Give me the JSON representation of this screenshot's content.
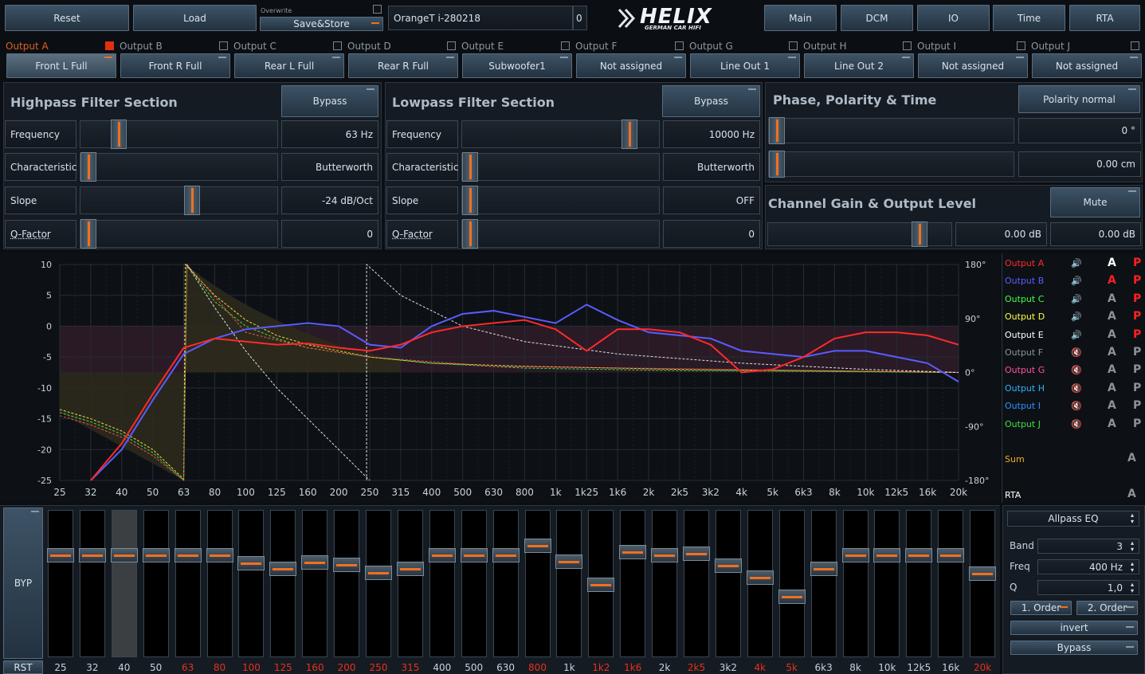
{
  "top": {
    "reset": "Reset",
    "load": "Load",
    "overwrite": "Overwrite",
    "save": "Save&Store",
    "preset_name": "OrangeT i-280218",
    "preset_num": "0",
    "logo": "HELIX",
    "logo_sub": "GERMAN CAR HIFI",
    "nav": [
      "Main",
      "DCM",
      "IO",
      "Time",
      "RTA"
    ]
  },
  "outputs": [
    {
      "label": "Output A",
      "assign": "Front L Full",
      "checked": true
    },
    {
      "label": "Output B",
      "assign": "Front R Full",
      "checked": false
    },
    {
      "label": "Output C",
      "assign": "Rear L Full",
      "checked": false
    },
    {
      "label": "Output D",
      "assign": "Rear R Full",
      "checked": false
    },
    {
      "label": "Output E",
      "assign": "Subwoofer1",
      "checked": false
    },
    {
      "label": "Output F",
      "assign": "Not assigned",
      "checked": false
    },
    {
      "label": "Output G",
      "assign": "Line Out 1",
      "checked": false
    },
    {
      "label": "Output H",
      "assign": "Line Out 2",
      "checked": false
    },
    {
      "label": "Output I",
      "assign": "Not assigned",
      "checked": false
    },
    {
      "label": "Output J",
      "assign": "Not assigned",
      "checked": false
    }
  ],
  "hp": {
    "title": "Highpass Filter Section",
    "bypass": "Bypass",
    "rows": [
      [
        "Frequency",
        "63 Hz"
      ],
      [
        "Characteristic",
        "Butterworth"
      ],
      [
        "Slope",
        "-24 dB/Oct"
      ],
      [
        "Q-Factor",
        "0"
      ]
    ]
  },
  "lp": {
    "title": "Lowpass Filter Section",
    "bypass": "Bypass",
    "rows": [
      [
        "Frequency",
        "10000 Hz"
      ],
      [
        "Characteristic",
        "Butterworth"
      ],
      [
        "Slope",
        "OFF"
      ],
      [
        "Q-Factor",
        "0"
      ]
    ]
  },
  "phase": {
    "title": "Phase, Polarity & Time",
    "polarity": "Polarity normal",
    "phase_val": "0 °",
    "time_val": "0.00 cm"
  },
  "gain": {
    "title": "Channel Gain & Output Level",
    "mute": "Mute",
    "gain_val": "0.00 dB",
    "level_val": "0.00 dB"
  },
  "graph": {
    "yleft": [
      "10",
      "5",
      "0",
      "-5",
      "-10",
      "-15",
      "-20",
      "-25"
    ],
    "yright": [
      "180°",
      "90°",
      "0°",
      "-90°",
      "-180°"
    ],
    "xticks": [
      "25",
      "32",
      "40",
      "50",
      "63",
      "80",
      "100",
      "125",
      "160",
      "200",
      "250",
      "315",
      "400",
      "500",
      "630",
      "800",
      "1k",
      "1k25",
      "1k6",
      "2k",
      "2k5",
      "3k2",
      "4k",
      "5k",
      "6k3",
      "8k",
      "10k",
      "12k5",
      "16k",
      "20k"
    ]
  },
  "legend": [
    {
      "name": "Output A",
      "color": "#ff2a2a",
      "a": "#ffffff",
      "p": "#ff2020"
    },
    {
      "name": "Output B",
      "color": "#5a5cff",
      "a": "#ff2020",
      "p": "#ff2020"
    },
    {
      "name": "Output C",
      "color": "#40ff40",
      "a": "#8a939c",
      "p": "#ff2020"
    },
    {
      "name": "Output D",
      "color": "#ffff40",
      "a": "#8a939c",
      "p": "#ff2020"
    },
    {
      "name": "Output E",
      "color": "#ffffff",
      "a": "#8a939c",
      "p": "#ff2020"
    },
    {
      "name": "Output F",
      "color": "#8a939c",
      "a": "#8a939c",
      "p": "#8a939c"
    },
    {
      "name": "Output G",
      "color": "#ff50a0",
      "a": "#8a939c",
      "p": "#8a939c"
    },
    {
      "name": "Output H",
      "color": "#30b0ff",
      "a": "#8a939c",
      "p": "#8a939c"
    },
    {
      "name": "Output I",
      "color": "#3090ff",
      "a": "#8a939c",
      "p": "#8a939c"
    },
    {
      "name": "Output J",
      "color": "#40e040",
      "a": "#8a939c",
      "p": "#8a939c"
    }
  ],
  "sum": {
    "label": "Sum",
    "a": "A"
  },
  "rta": {
    "label": "RTA",
    "a": "A"
  },
  "eq": {
    "byp": "BYP",
    "rst": "RST",
    "bands": [
      {
        "f": "25",
        "red": false,
        "db": 0
      },
      {
        "f": "32",
        "red": false,
        "db": 0
      },
      {
        "f": "40",
        "red": false,
        "db": 0,
        "sel": true
      },
      {
        "f": "50",
        "red": false,
        "db": 0
      },
      {
        "f": "63",
        "red": true,
        "db": 0
      },
      {
        "f": "80",
        "red": true,
        "db": 0
      },
      {
        "f": "100",
        "red": true,
        "db": -1.2
      },
      {
        "f": "125",
        "red": true,
        "db": -2
      },
      {
        "f": "160",
        "red": true,
        "db": -1.1
      },
      {
        "f": "200",
        "red": true,
        "db": -1.4
      },
      {
        "f": "250",
        "red": true,
        "db": -2.6
      },
      {
        "f": "315",
        "red": true,
        "db": -2
      },
      {
        "f": "400",
        "red": false,
        "db": 0
      },
      {
        "f": "500",
        "red": false,
        "db": 0
      },
      {
        "f": "630",
        "red": false,
        "db": 0
      },
      {
        "f": "800",
        "red": true,
        "db": 1.5
      },
      {
        "f": "1k",
        "red": false,
        "db": -1
      },
      {
        "f": "1k2",
        "red": true,
        "db": -4.4
      },
      {
        "f": "1k6",
        "red": true,
        "db": 0.5
      },
      {
        "f": "2k",
        "red": false,
        "db": 0
      },
      {
        "f": "2k5",
        "red": true,
        "db": 0.2
      },
      {
        "f": "3k2",
        "red": false,
        "db": -1.6
      },
      {
        "f": "4k",
        "red": true,
        "db": -3.4
      },
      {
        "f": "5k",
        "red": true,
        "db": -6.3
      },
      {
        "f": "6k3",
        "red": false,
        "db": -2
      },
      {
        "f": "8k",
        "red": false,
        "db": 0
      },
      {
        "f": "10k",
        "red": false,
        "db": 0
      },
      {
        "f": "12k5",
        "red": false,
        "db": 0
      },
      {
        "f": "16k",
        "red": false,
        "db": 0
      },
      {
        "f": "20k",
        "red": true,
        "db": -2.8
      }
    ]
  },
  "allpass": {
    "mode": "Allpass EQ",
    "band_lbl": "Band",
    "band": "3",
    "freq_lbl": "Freq",
    "freq": "400 Hz",
    "q_lbl": "Q",
    "q": "1,0",
    "ord1": "1. Order",
    "ord2": "2. Order",
    "invert": "invert",
    "bypass": "Bypass"
  }
}
